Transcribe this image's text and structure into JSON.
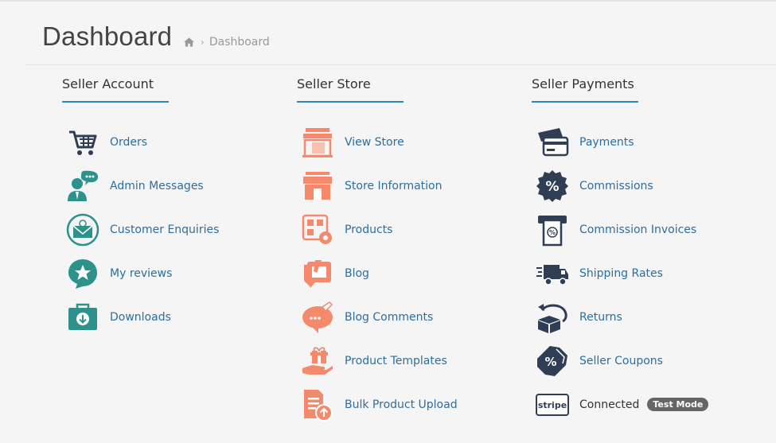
{
  "header": {
    "title": "Dashboard",
    "breadcrumb": {
      "current": "Dashboard",
      "separator": "›"
    }
  },
  "colors": {
    "teal": "#2d918c",
    "navy": "#2f3e55",
    "salmon": "#f4896b",
    "link": "#2c6ea0",
    "underline": "#2f86bd"
  },
  "seller_account": {
    "title": "Seller Account",
    "items": [
      {
        "label": "Orders",
        "icon": "cart-icon"
      },
      {
        "label": "Admin Messages",
        "icon": "support-agent-icon"
      },
      {
        "label": "Customer Enquiries",
        "icon": "email-enquiry-icon"
      },
      {
        "label": "My reviews",
        "icon": "star-review-icon"
      },
      {
        "label": "Downloads",
        "icon": "download-box-icon"
      }
    ]
  },
  "seller_store": {
    "title": "Seller Store",
    "items": [
      {
        "label": "View Store",
        "icon": "storefront-icon"
      },
      {
        "label": "Store Information",
        "icon": "store-info-icon"
      },
      {
        "label": "Products",
        "icon": "products-gear-icon"
      },
      {
        "label": "Blog",
        "icon": "blog-icon"
      },
      {
        "label": "Blog Comments",
        "icon": "comment-bubble-icon"
      },
      {
        "label": "Product Templates",
        "icon": "gift-hand-icon"
      },
      {
        "label": "Bulk Product Upload",
        "icon": "upload-file-icon"
      }
    ]
  },
  "seller_payments": {
    "title": "Seller Payments",
    "items": [
      {
        "label": "Payments",
        "icon": "credit-card-icon"
      },
      {
        "label": "Commissions",
        "icon": "percent-badge-icon"
      },
      {
        "label": "Commission Invoices",
        "icon": "invoice-icon"
      },
      {
        "label": "Shipping Rates",
        "icon": "truck-icon"
      },
      {
        "label": "Returns",
        "icon": "return-box-icon"
      },
      {
        "label": "Seller Coupons",
        "icon": "coupon-icon"
      }
    ],
    "stripe": {
      "logo_text": "stripe",
      "status": "Connected",
      "badge": "Test Mode"
    }
  }
}
